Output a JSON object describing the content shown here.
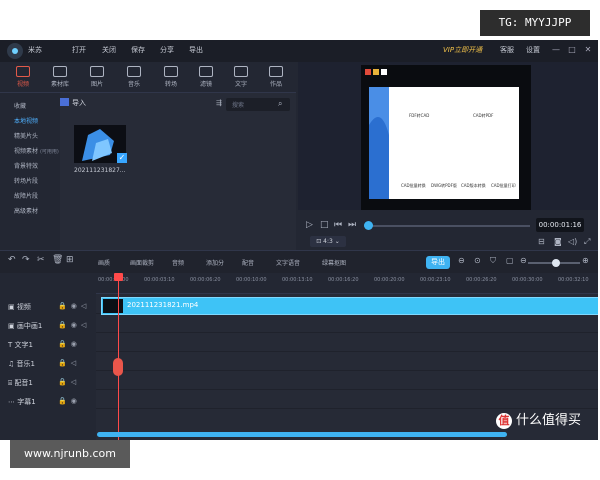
{
  "watermark": "TG: MYYJJPP",
  "site": "www.njrunb.com",
  "app": {
    "name": "米苏",
    "menu": [
      "打开",
      "关闭",
      "保存",
      "分享",
      "导出"
    ],
    "vip": "VIP立即开通",
    "menu_right": [
      "客服",
      "设置"
    ],
    "window_buttons": [
      "—",
      "□",
      "✕"
    ]
  },
  "categories": [
    "视频",
    "素材库",
    "图片",
    "音乐",
    "转场",
    "滤镜",
    "文字",
    "作品"
  ],
  "leftnav": [
    "收藏",
    "本地视频",
    "精美片头",
    "视频素材",
    "背景特效",
    "转场片段",
    "故障片段",
    "高级素材"
  ],
  "leftnav_tag": "(可用用)",
  "media": {
    "import_label": "导入",
    "search_placeholder": "搜索",
    "thumbnail_name": "202111231827..."
  },
  "preview": {
    "timecode": "00:00:01:16",
    "ratio": "4:3",
    "screen_labels": [
      "FDF转CAD",
      "CAD转PDF",
      "CAD批量转换",
      "DWG转PDF版",
      "CAD版本转换",
      "CAD批量打印"
    ]
  },
  "toolbar": {
    "items": [
      "画质",
      "画面裁剪",
      "音频",
      "添加分",
      "配音",
      "文字语音",
      "绿幕抠图"
    ],
    "export": "导出"
  },
  "ruler": [
    "00:00:00:00",
    "00:00:03:10",
    "00:00:06:20",
    "00:00:10:00",
    "00:00:13:10",
    "00:00:16:20",
    "00:00:20:00",
    "00:00:23:10",
    "00:00:26:20",
    "00:00:30:00",
    "00:00:32:10"
  ],
  "tracks": [
    "视频",
    "画中画1",
    "文字1",
    "音乐1",
    "配音1",
    "字幕1"
  ],
  "clip_name": "202111231821.mp4",
  "corner_text": "什么值得买",
  "corner_logo": "值"
}
